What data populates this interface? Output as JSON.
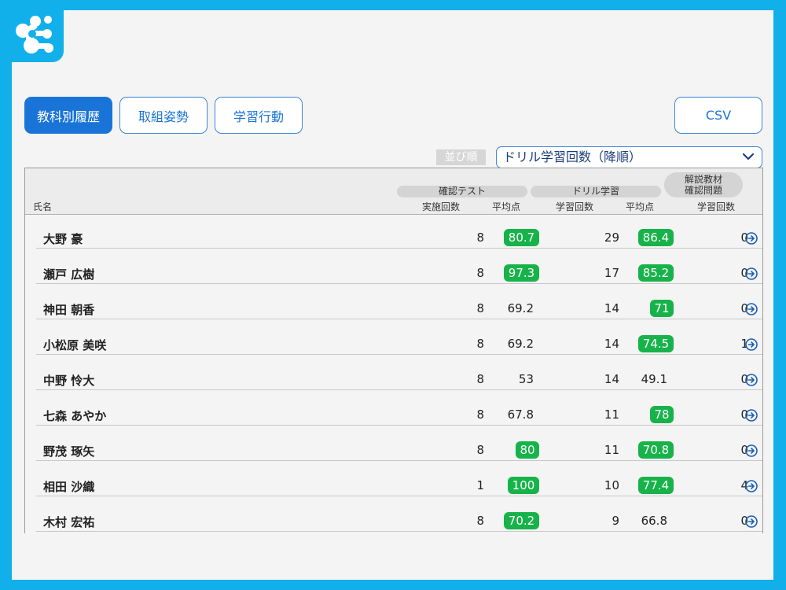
{
  "tabs": [
    {
      "label": "教科別履歴",
      "active": true
    },
    {
      "label": "取組姿勢",
      "active": false
    },
    {
      "label": "学習行動",
      "active": false
    }
  ],
  "csv_label": "CSV",
  "sort": {
    "label": "並び順",
    "selected": "ドリル学習回数（降順）"
  },
  "header": {
    "name": "氏名",
    "group_test": "確認テスト",
    "group_drill": "ドリル学習",
    "group_review_line1": "解説教材",
    "group_review_line2": "確認問題",
    "test_count": "実施回数",
    "test_avg": "平均点",
    "drill_count": "学習回数",
    "drill_avg": "平均点",
    "review_count": "学習回数"
  },
  "rows": [
    {
      "name": "大野 豪",
      "test_count": "8",
      "test_avg": "80.7",
      "test_hi": true,
      "drill_count": "29",
      "drill_avg": "86.4",
      "drill_hi": true,
      "review_count": "0"
    },
    {
      "name": "瀬戸 広樹",
      "test_count": "8",
      "test_avg": "97.3",
      "test_hi": true,
      "drill_count": "17",
      "drill_avg": "85.2",
      "drill_hi": true,
      "review_count": "0"
    },
    {
      "name": "神田 朝香",
      "test_count": "8",
      "test_avg": "69.2",
      "test_hi": false,
      "drill_count": "14",
      "drill_avg": "71",
      "drill_hi": true,
      "review_count": "0"
    },
    {
      "name": "小松原 美咲",
      "test_count": "8",
      "test_avg": "69.2",
      "test_hi": false,
      "drill_count": "14",
      "drill_avg": "74.5",
      "drill_hi": true,
      "review_count": "1"
    },
    {
      "name": "中野 怜大",
      "test_count": "8",
      "test_avg": "53",
      "test_hi": false,
      "drill_count": "14",
      "drill_avg": "49.1",
      "drill_hi": false,
      "review_count": "0"
    },
    {
      "name": "七森 あやか",
      "test_count": "8",
      "test_avg": "67.8",
      "test_hi": false,
      "drill_count": "11",
      "drill_avg": "78",
      "drill_hi": true,
      "review_count": "0"
    },
    {
      "name": "野茂 琢矢",
      "test_count": "8",
      "test_avg": "80",
      "test_hi": true,
      "drill_count": "11",
      "drill_avg": "70.8",
      "drill_hi": true,
      "review_count": "0"
    },
    {
      "name": "相田 沙織",
      "test_count": "1",
      "test_avg": "100",
      "test_hi": true,
      "drill_count": "10",
      "drill_avg": "77.4",
      "drill_hi": true,
      "review_count": "4"
    },
    {
      "name": "木村 宏祐",
      "test_count": "8",
      "test_avg": "70.2",
      "test_hi": true,
      "drill_count": "9",
      "drill_avg": "66.8",
      "drill_hi": false,
      "review_count": "0"
    }
  ],
  "colors": {
    "accent": "#1a74d8",
    "highlight": "#17b34a",
    "frame": "#12b0ea"
  },
  "icons": {
    "logo": "app-logo",
    "row_link": "arrow-right-circle-icon",
    "dropdown": "chevron-down-icon"
  }
}
